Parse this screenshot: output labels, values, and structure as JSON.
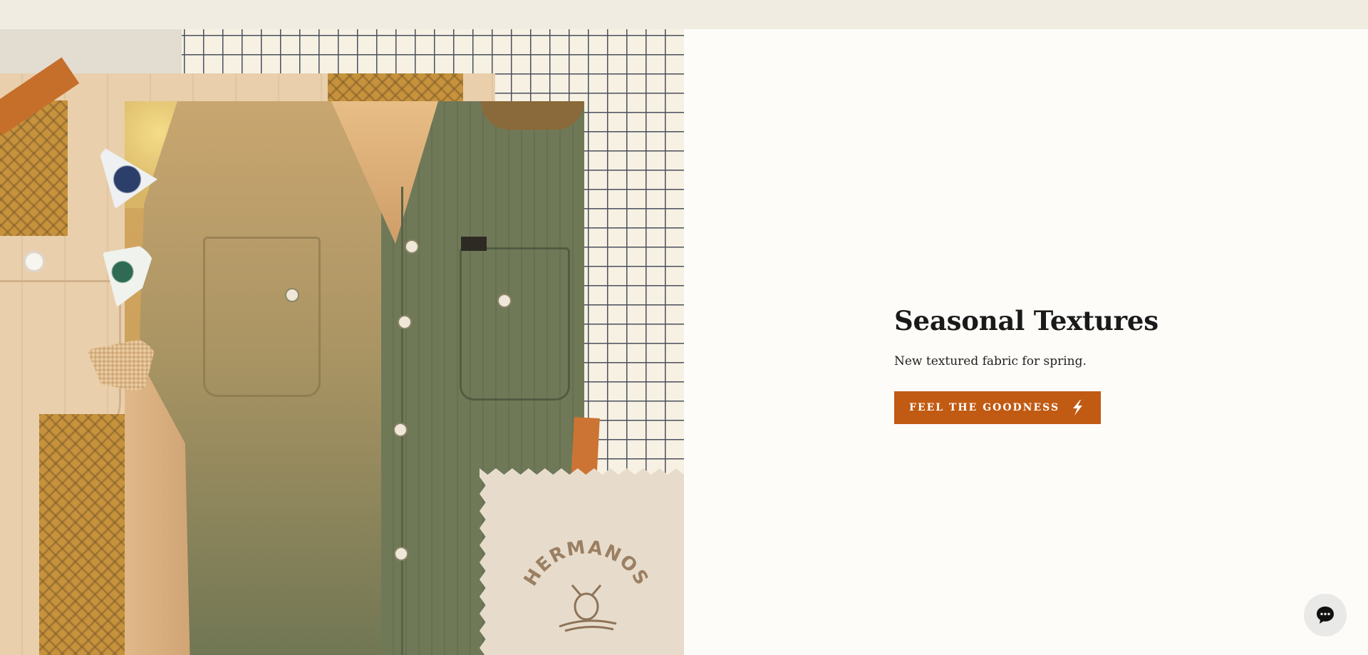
{
  "hero": {
    "title": "Seasonal Textures",
    "subtitle": "New textured fabric for spring.",
    "cta_label": "FEEL THE GOODNESS",
    "cta_icon": "lightning-bolt-icon",
    "accent_color": "#c15a12"
  },
  "collage": {
    "patch_text": "HERMANOS"
  },
  "chat": {
    "icon": "chat-bubble-icon"
  }
}
